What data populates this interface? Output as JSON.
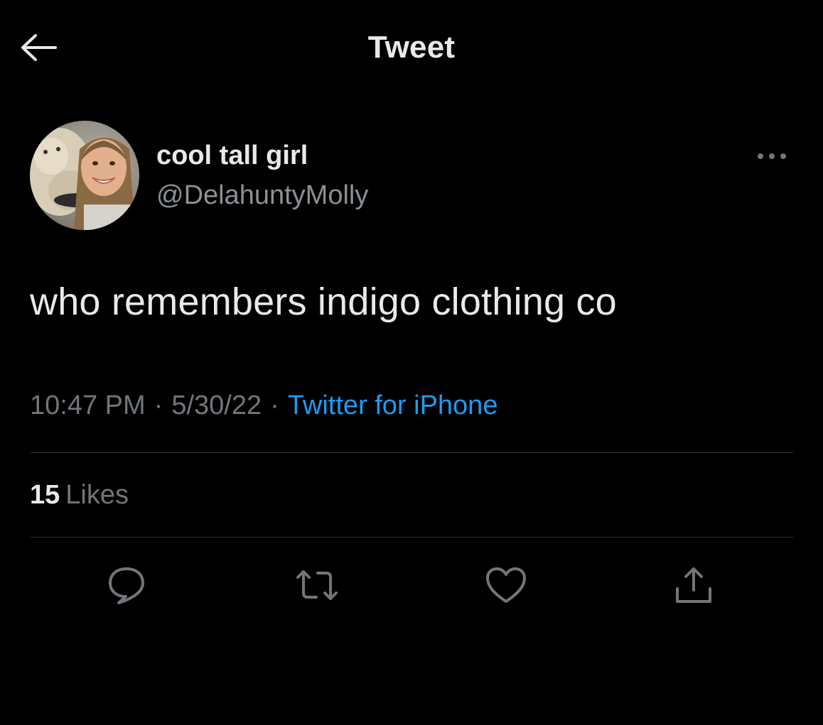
{
  "header": {
    "title": "Tweet",
    "back_icon": "arrow-left-icon"
  },
  "author": {
    "display_name": "cool tall girl",
    "handle": "@DelahuntyMolly",
    "more_icon": "more-horizontal-icon"
  },
  "tweet": {
    "text": "who remembers indigo clothing co",
    "time": "10:47 PM",
    "date": "5/30/22",
    "separator": "·",
    "source": "Twitter for iPhone"
  },
  "stats": {
    "likes_count": "15",
    "likes_label": "Likes"
  },
  "actions": [
    {
      "icon": "reply-icon"
    },
    {
      "icon": "retweet-icon"
    },
    {
      "icon": "like-heart-icon"
    },
    {
      "icon": "share-icon"
    }
  ],
  "colors": {
    "background": "#000000",
    "text_primary": "#e7e9ea",
    "text_secondary": "#71767b",
    "link_blue": "#1d9bf0",
    "divider": "#2f3336"
  }
}
